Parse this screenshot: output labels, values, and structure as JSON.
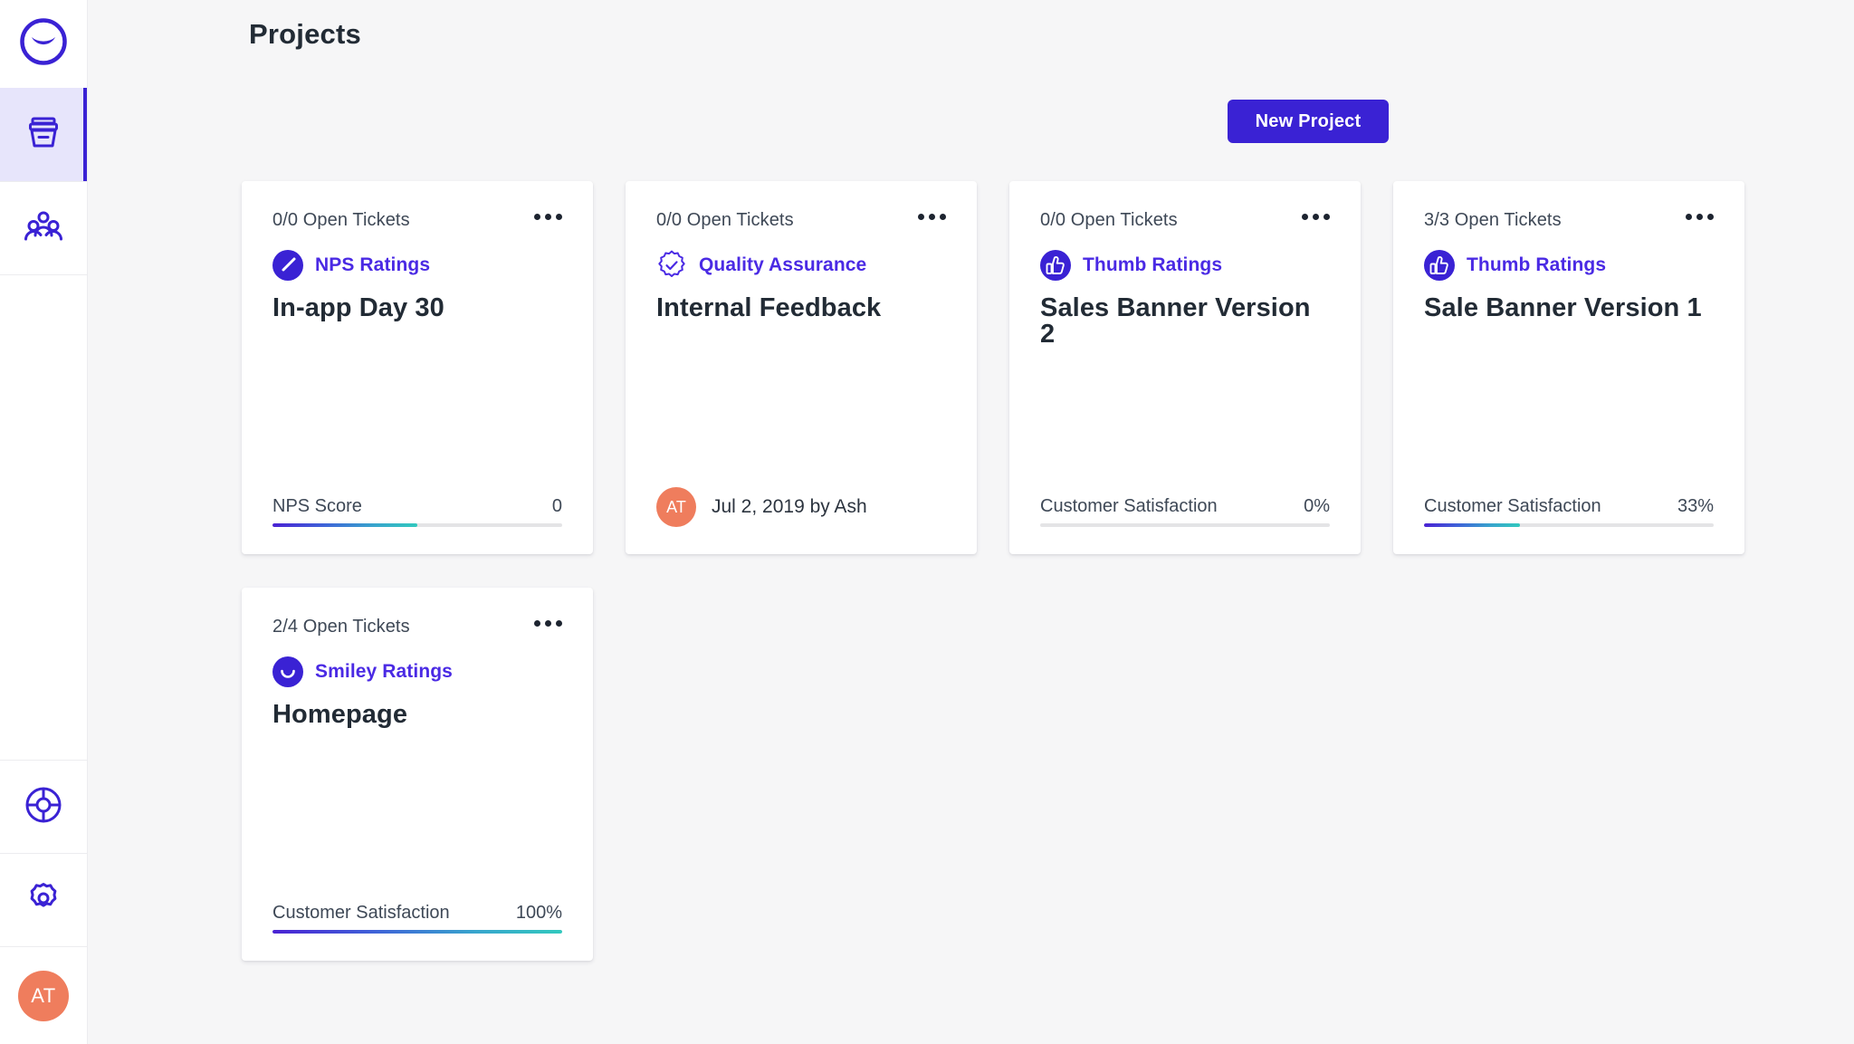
{
  "sidebar": {
    "logo": {
      "icon": "smiley-logo-icon",
      "name": "brand-logo"
    },
    "items": [
      {
        "id": "projects",
        "icon": "archive-box-icon",
        "label": "Projects",
        "active": true
      },
      {
        "id": "team",
        "icon": "people-group-icon",
        "label": "Team",
        "active": false
      }
    ],
    "bottom_items": [
      {
        "id": "help",
        "icon": "life-ring-icon",
        "label": "Help"
      },
      {
        "id": "settings",
        "icon": "gear-icon",
        "label": "Settings"
      }
    ],
    "avatar": {
      "initials": "AT",
      "color": "#ef7d5d"
    }
  },
  "header": {
    "title": "Projects",
    "new_project_label": "New Project"
  },
  "colors": {
    "accent": "#3a22d4",
    "type_label": "#4a2ae4",
    "avatar": "#ef7d5d",
    "bar_start": "#4a22d4",
    "bar_end": "#32c9be",
    "background": "#f6f6f7",
    "card": "#ffffff",
    "title_text": "#222b35"
  },
  "cards": [
    {
      "tickets": "0/0 Open Tickets",
      "type_icon": "nps-gauge-icon",
      "type_label": "NPS Ratings",
      "title": "In-app Day 30",
      "footer_kind": "metric",
      "metric_label": "NPS Score",
      "metric_value": "0",
      "bar_percent": 50
    },
    {
      "tickets": "0/0 Open Tickets",
      "type_icon": "quality-seal-check-icon",
      "type_label": "Quality Assurance",
      "title": "Internal Feedback",
      "footer_kind": "byline",
      "byline_initials": "AT",
      "byline_text": "Jul 2, 2019 by Ash"
    },
    {
      "tickets": "0/0 Open Tickets",
      "type_icon": "thumbs-up-icon",
      "type_label": "Thumb Ratings",
      "title": "Sales Banner Version 2",
      "footer_kind": "metric",
      "metric_label": "Customer Satisfaction",
      "metric_value": "0%",
      "bar_percent": 0
    },
    {
      "tickets": "3/3 Open Tickets",
      "type_icon": "thumbs-up-icon",
      "type_label": "Thumb Ratings",
      "title": "Sale Banner Version 1",
      "footer_kind": "metric",
      "metric_label": "Customer Satisfaction",
      "metric_value": "33%",
      "bar_percent": 33
    },
    {
      "tickets": "2/4 Open Tickets",
      "type_icon": "smiley-face-icon",
      "type_label": "Smiley Ratings",
      "title": "Homepage",
      "footer_kind": "metric",
      "metric_label": "Customer Satisfaction",
      "metric_value": "100%",
      "bar_percent": 100
    }
  ]
}
